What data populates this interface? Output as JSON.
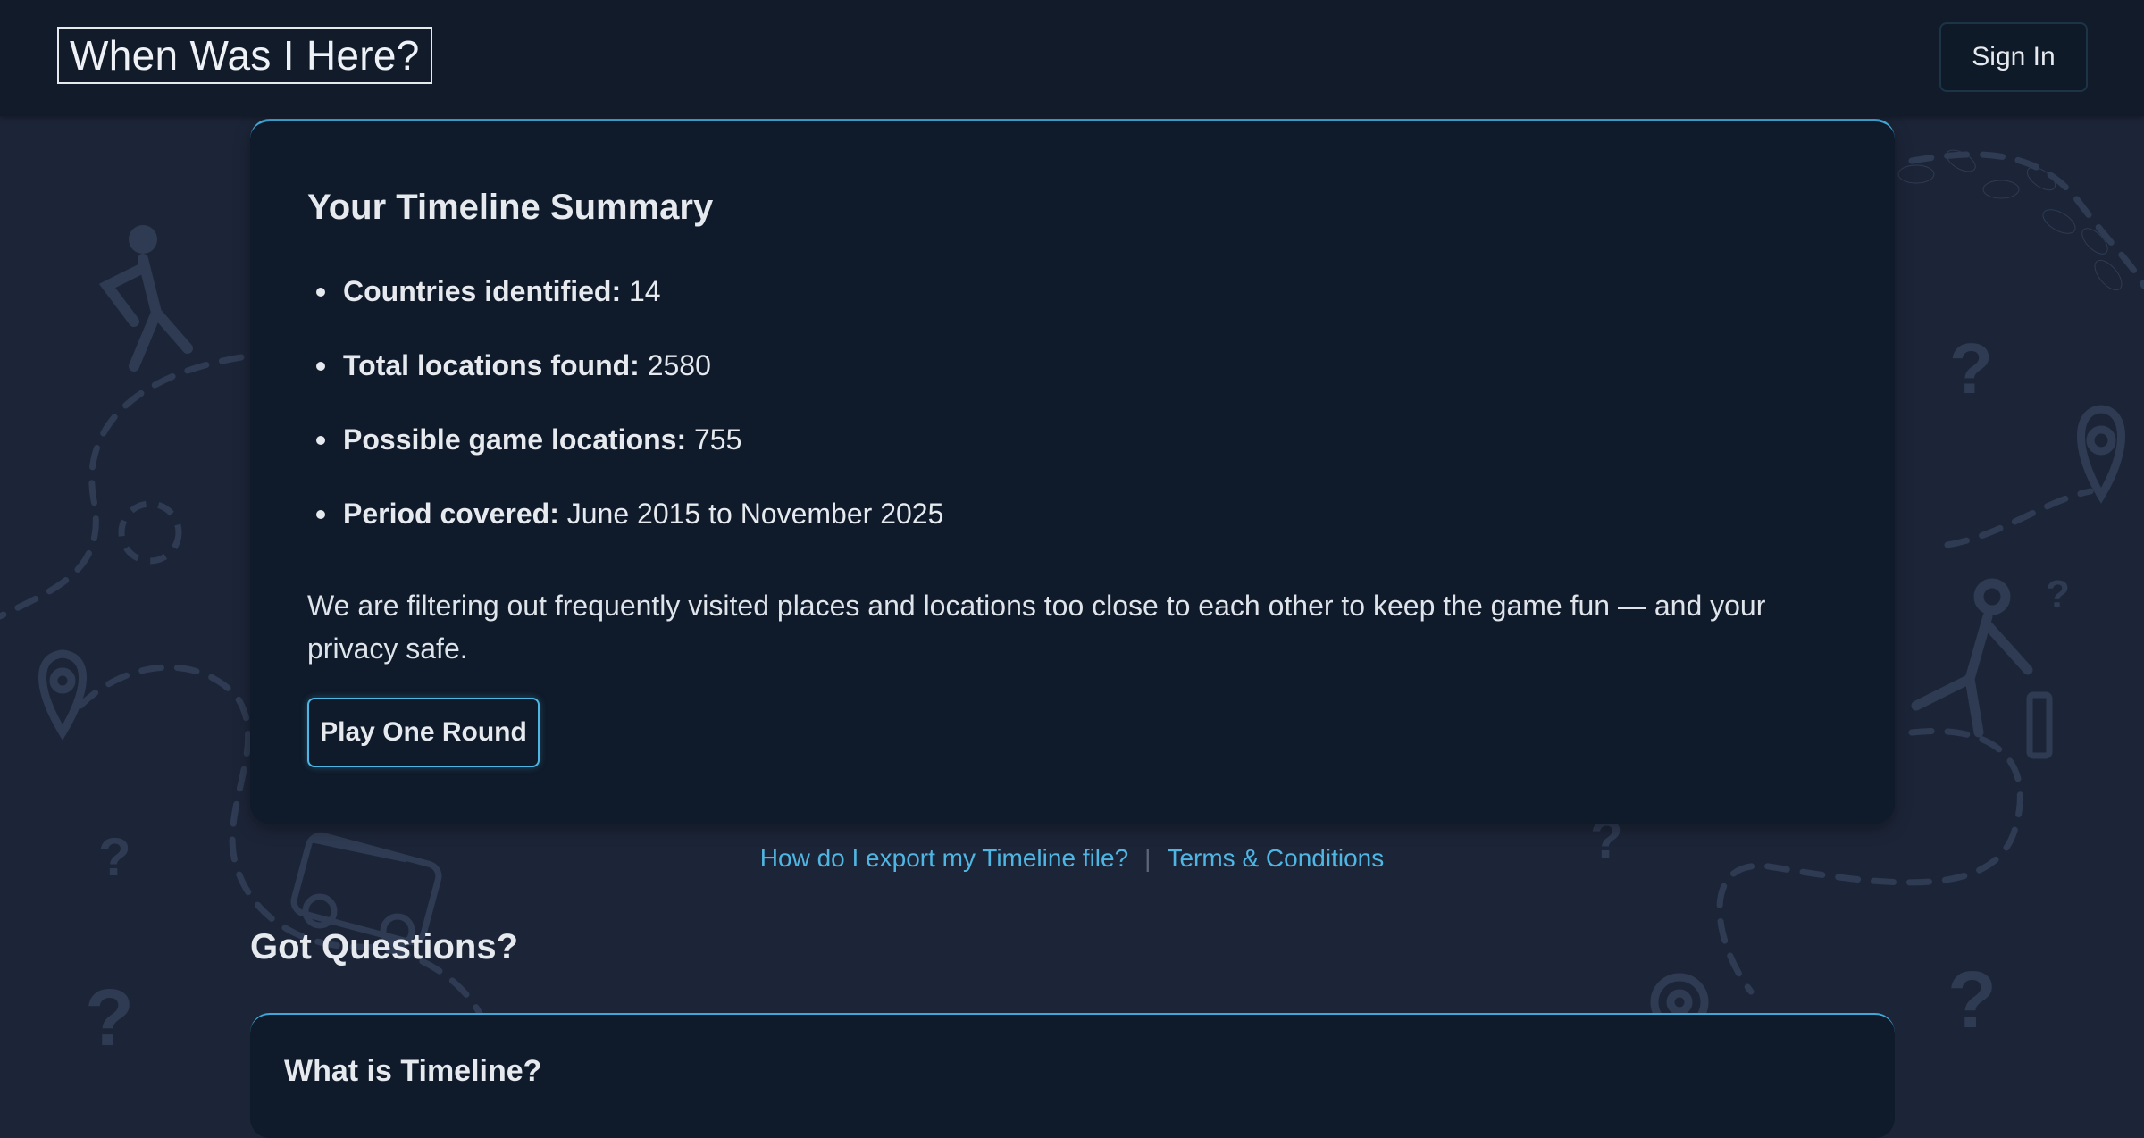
{
  "header": {
    "logo_text": "When Was I Here?",
    "signin_label": "Sign In"
  },
  "summary": {
    "title": "Your Timeline Summary",
    "stats": [
      {
        "label": "Countries identified:",
        "value": "14"
      },
      {
        "label": "Total locations found:",
        "value": "2580"
      },
      {
        "label": "Possible game locations:",
        "value": "755"
      },
      {
        "label": "Period covered:",
        "value": "June 2015 to November 2025"
      }
    ],
    "note": "We are filtering out frequently visited places and locations too close to each other to keep the game fun — and your privacy safe.",
    "play_label": "Play One Round"
  },
  "links": {
    "export_help": "How do I export my Timeline file?",
    "separator": "|",
    "terms": "Terms & Conditions"
  },
  "faq": {
    "title": "Got Questions?",
    "items": [
      {
        "question": "What is Timeline?"
      }
    ]
  },
  "colors": {
    "background": "#1c2538",
    "card": "#0f1a2a",
    "accent": "#3ea8d8",
    "link": "#4fb6e3"
  }
}
